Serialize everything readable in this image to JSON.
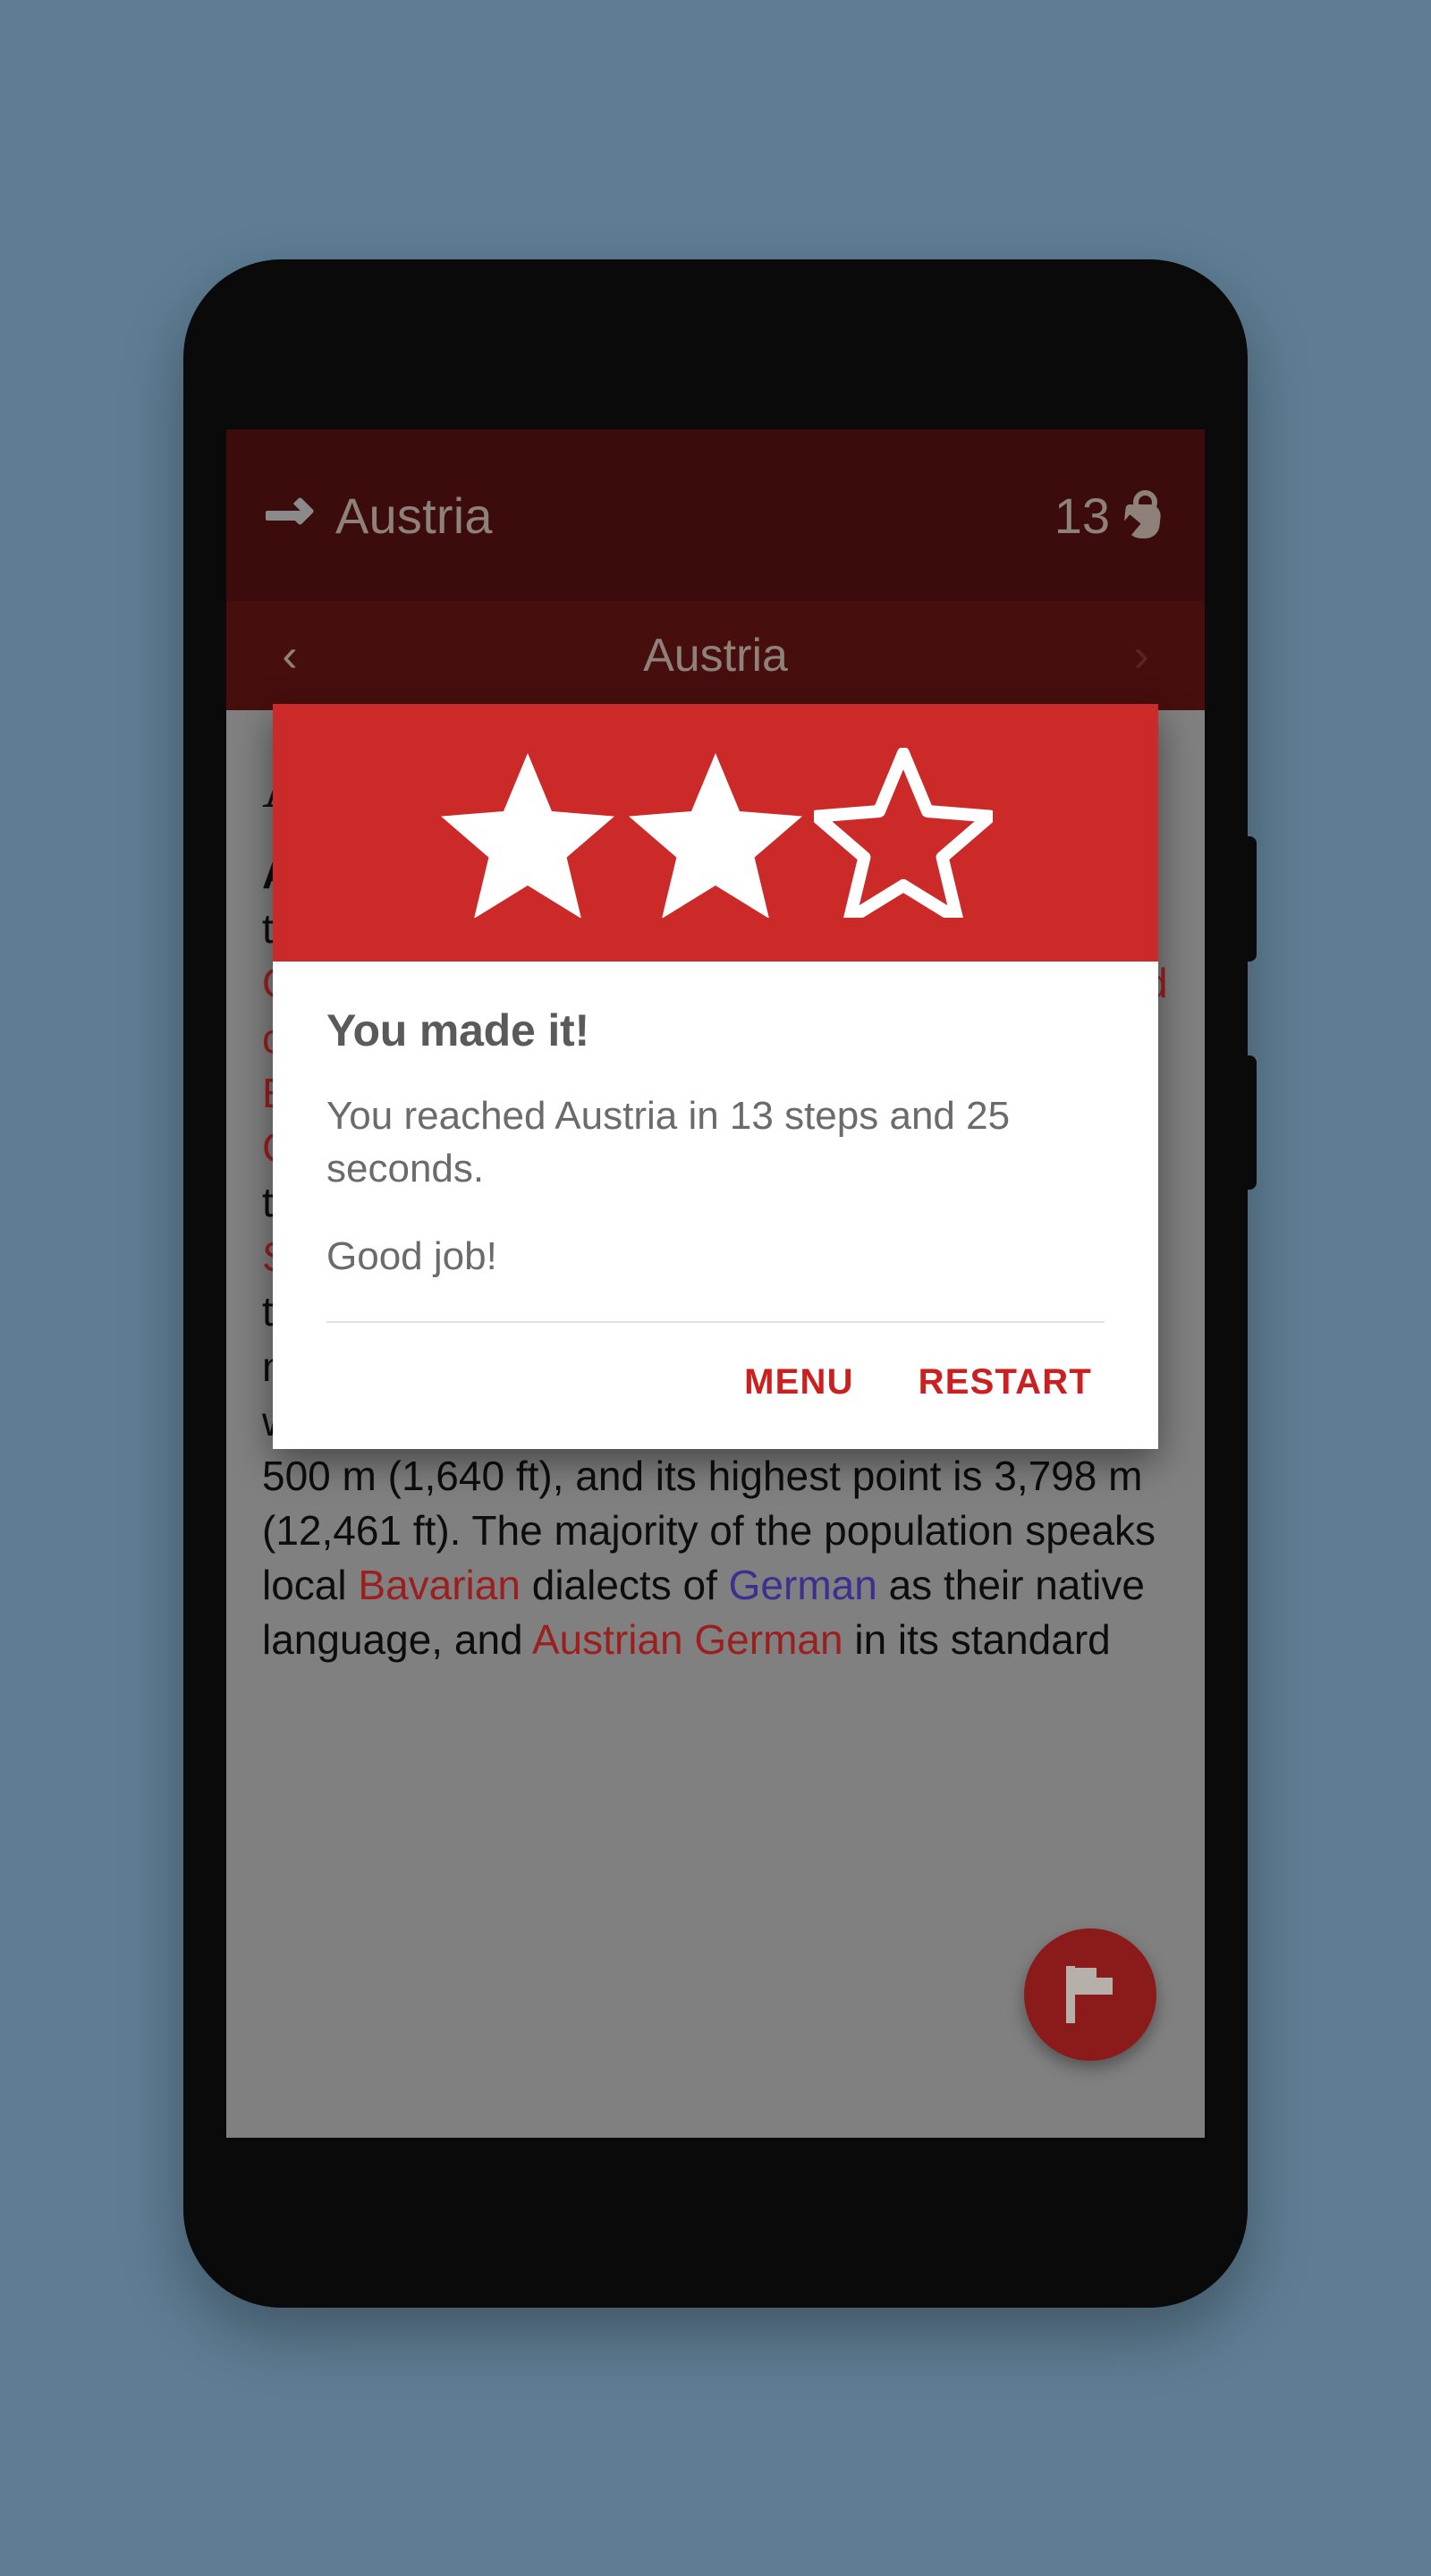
{
  "theme": {
    "page_background": "#5E7D93",
    "app_bar": "#3C0C0C",
    "nav_bar": "#470E0E",
    "accent_red": "#CC2929",
    "action_red": "#CC2020",
    "fab": "#8B1A1A",
    "scrim_grey": "#808080"
  },
  "app_bar": {
    "goal_icon": "arrow-right-icon",
    "goal_title": "Austria",
    "step_count": "13",
    "step_icon": "tap-icon"
  },
  "article_nav": {
    "prev_icon": "chevron-left-icon",
    "title": "Austria",
    "next_icon": "chevron-right-icon"
  },
  "article": {
    "heading": "Austria",
    "paragraph_html": "<b>Austria</b> (<span class=\"lnk\">['ɒstrɪə]</span>; <span class=\"lnk\">German</span>: <span class=\"lnk\">Österreich</span>), officially the <span class=\"lnk\">Republic of Austria</span> (German: <span class=\"lnk\">Republik Österreich</span>), is a <span class=\"lnk\">federal republic</span> and a <span class=\"lnk\">landlocked country</span> of over 8.7 million people in <span class=\"lnk\">Central Europe</span>. It is bordered by the <span class=\"lnk\">Czech Republic</span> and <span class=\"lnk\">Germany</span> to the north, <span class=\"lnk\">Hungary</span> and <span class=\"lnk\">Slovakia</span> to the east, <span class=\"lnk\">Slovenia</span> and <span class=\"lnk\">Italy</span> to the south, and <span class=\"lnk\">Switzerland</span> and <span class=\"lnk\">Liechtenstein</span> to the west. The territory of Austria covers 83,879 km2 (32,386 sq mi). The terrain is highly mountainous, lying within the <span class=\"lnk\">Alps</span>; only 32% of the country is below 500 m (1,640 ft), and its highest point is 3,798 m (12,461 ft). The majority of the population speaks local <span class=\"lnk\">Bavarian</span> dialects of <span class=\"lnk-blue\">German</span> as their native language, and <span class=\"lnk\">Austrian German</span> in its standard"
  },
  "fab": {
    "icon": "flag-icon"
  },
  "dialog": {
    "stars": {
      "total": 3,
      "filled": 2,
      "states": [
        "filled",
        "filled",
        "outline"
      ]
    },
    "title": "You made it!",
    "body_line_1": "You reached Austria in 13 steps and 25 seconds.",
    "body_line_2": "Good job!",
    "actions": {
      "menu_label": "MENU",
      "restart_label": "RESTART"
    }
  }
}
